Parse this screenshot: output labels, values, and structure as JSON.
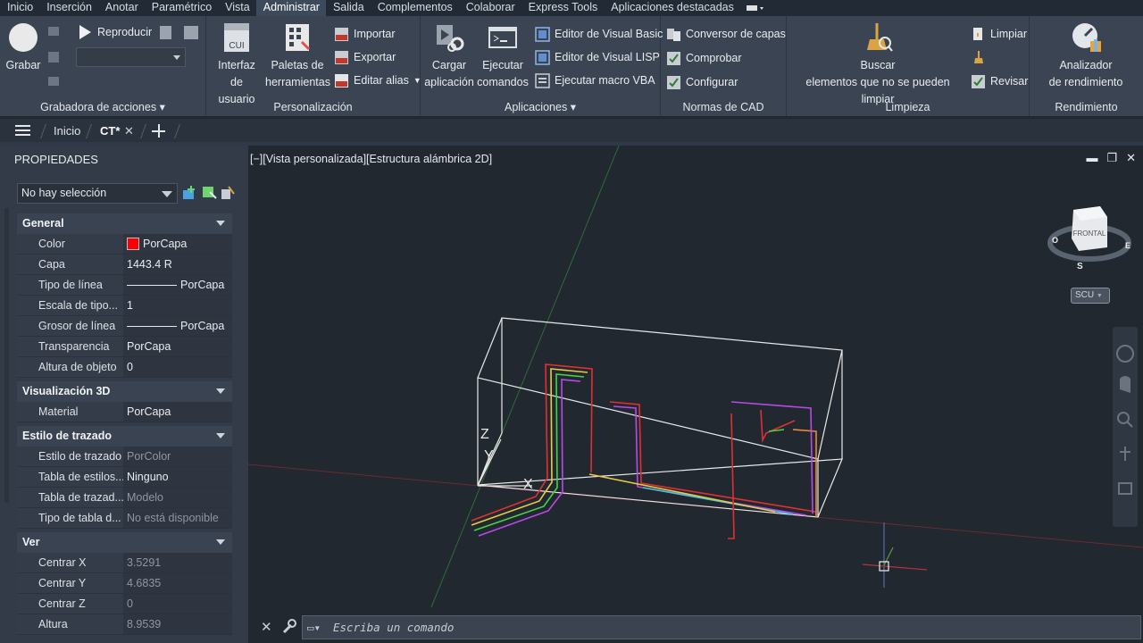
{
  "menubar": {
    "items": [
      "Inicio",
      "Inserción",
      "Anotar",
      "Paramétrico",
      "Vista",
      "Administrar",
      "Salida",
      "Complementos",
      "Colaborar",
      "Express Tools",
      "Aplicaciones destacadas"
    ],
    "active_index": 5
  },
  "ribbon": {
    "grabadora": {
      "title": "Grabadora de acciones",
      "grabar": "Grabar",
      "reproducir": "Reproducir"
    },
    "personalizacion": {
      "title": "Personalización",
      "interfaz_l1": "Interfaz",
      "interfaz_l2": "de usuario",
      "cui": "CUI",
      "paletas_l1": "Paletas de",
      "paletas_l2": "herramientas",
      "importar": "Importar",
      "exportar": "Exportar",
      "editar_alias": "Editar alias"
    },
    "aplicaciones": {
      "title": "Aplicaciones",
      "cargar_l1": "Cargar",
      "cargar_l2": "aplicación",
      "ejecutar_l1": "Ejecutar",
      "ejecutar_l2": "comandos",
      "vb": "Editor de Visual Basic",
      "lisp": "Editor de Visual LISP",
      "vba": "Ejecutar macro VBA"
    },
    "normas": {
      "title": "Normas de CAD",
      "conversor": "Conversor de capas",
      "comprobar": "Comprobar",
      "configurar": "Configurar"
    },
    "limpieza": {
      "title": "Limpieza",
      "buscar_l1": "Buscar",
      "buscar_l2": "elementos que no se pueden limpiar",
      "limpiar": "Limpiar",
      "revisar": "Revisar"
    },
    "rendimiento": {
      "title": "Rendimiento",
      "analizador_l1": "Analizador",
      "analizador_l2": "de rendimiento"
    }
  },
  "tabs": {
    "inicio": "Inicio",
    "ct": "CT*"
  },
  "palette": {
    "title": "PROPIEDADES",
    "selection": "No hay selección",
    "general": {
      "title": "General",
      "rows": [
        {
          "k": "Color",
          "v": "PorCapa"
        },
        {
          "k": "Capa",
          "v": "1443.4 R"
        },
        {
          "k": "Tipo de línea",
          "v": "PorCapa"
        },
        {
          "k": "Escala de tipo...",
          "v": "1"
        },
        {
          "k": "Grosor de línea",
          "v": "PorCapa"
        },
        {
          "k": "Transparencia",
          "v": "PorCapa"
        },
        {
          "k": "Altura de objeto",
          "v": "0"
        }
      ]
    },
    "vis3d": {
      "title": "Visualización 3D",
      "rows": [
        {
          "k": "Material",
          "v": "PorCapa"
        }
      ]
    },
    "trazado": {
      "title": "Estilo de trazado",
      "rows": [
        {
          "k": "Estilo de trazado",
          "v": "PorColor"
        },
        {
          "k": "Tabla de estilos...",
          "v": "Ninguno"
        },
        {
          "k": "Tabla de trazad...",
          "v": "Modelo"
        },
        {
          "k": "Tipo de tabla d...",
          "v": "No está disponible"
        }
      ]
    },
    "ver": {
      "title": "Ver",
      "rows": [
        {
          "k": "Centrar X",
          "v": "3.5291"
        },
        {
          "k": "Centrar Y",
          "v": "4.6835"
        },
        {
          "k": "Centrar Z",
          "v": "0"
        },
        {
          "k": "Altura",
          "v": "8.9539"
        }
      ]
    }
  },
  "viewport": {
    "label": "[−][Vista personalizada][Estructura alámbrica 2D]",
    "viewcube_face": "FRONTAL",
    "compass_o": "O",
    "compass_e": "E",
    "compass_s": "S",
    "ucs": "SCU",
    "axis_x": "X",
    "axis_y": "Y",
    "axis_z": "Z"
  },
  "command": {
    "placeholder": "Escriba un comando"
  },
  "colors": {
    "accent": "#3d4a5c",
    "ribbon": "#3b4453",
    "palette": "#333b48",
    "canvas": "#212830"
  }
}
